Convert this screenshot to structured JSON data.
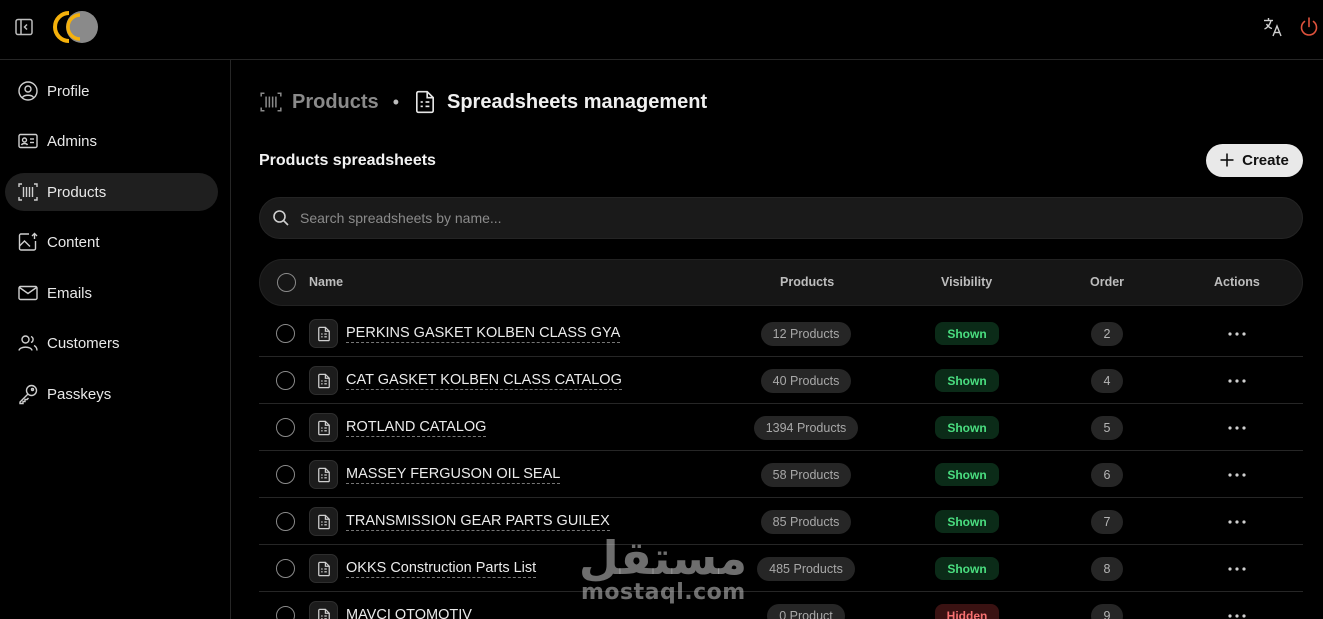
{
  "topbar": {
    "sidebar_toggle_icon": "sidebar-collapse-icon",
    "logo_icon": "cc-logo",
    "translate_icon": "translate-icon",
    "power_icon": "power-icon",
    "colors": {
      "logo_accent": "#f5b10b",
      "power": "#e0523c"
    }
  },
  "sidebar": {
    "items": [
      {
        "label": "Profile",
        "icon": "user-circle-icon",
        "active": false
      },
      {
        "label": "Admins",
        "icon": "id-card-icon",
        "active": false
      },
      {
        "label": "Products",
        "icon": "barcode-icon",
        "active": true
      },
      {
        "label": "Content",
        "icon": "image-upload-icon",
        "active": false
      },
      {
        "label": "Emails",
        "icon": "mail-icon",
        "active": false
      },
      {
        "label": "Customers",
        "icon": "users-icon",
        "active": false
      },
      {
        "label": "Passkeys",
        "icon": "key-icon",
        "active": false
      }
    ]
  },
  "breadcrumb": {
    "parent": "Products",
    "separator": "•",
    "current": "Spreadsheets management"
  },
  "section": {
    "title": "Products spreadsheets",
    "create_label": "Create"
  },
  "search": {
    "placeholder": "Search spreadsheets by name...",
    "value": ""
  },
  "table": {
    "columns": {
      "name": "Name",
      "products": "Products",
      "visibility": "Visibility",
      "order": "Order",
      "actions": "Actions"
    },
    "rows": [
      {
        "name": "PERKINS GASKET KOLBEN CLASS GYA",
        "products": "12 Products",
        "visibility": "Shown",
        "order": "2"
      },
      {
        "name": "CAT GASKET KOLBEN CLASS CATALOG",
        "products": "40 Products",
        "visibility": "Shown",
        "order": "4"
      },
      {
        "name": "ROTLAND CATALOG",
        "products": "1394 Products",
        "visibility": "Shown",
        "order": "5"
      },
      {
        "name": "MASSEY FERGUSON OIL SEAL",
        "products": "58 Products",
        "visibility": "Shown",
        "order": "6"
      },
      {
        "name": "TRANSMISSION GEAR PARTS GUILEX",
        "products": "85 Products",
        "visibility": "Shown",
        "order": "7"
      },
      {
        "name": "OKKS Construction Parts List",
        "products": "485 Products",
        "visibility": "Shown",
        "order": "8"
      },
      {
        "name": "MAVCI OTOMOTIV",
        "products": "0 Product",
        "visibility": "Hidden",
        "order": "9"
      }
    ]
  },
  "watermark": {
    "arabic": "مستقل",
    "latin": "mostaql.com"
  }
}
